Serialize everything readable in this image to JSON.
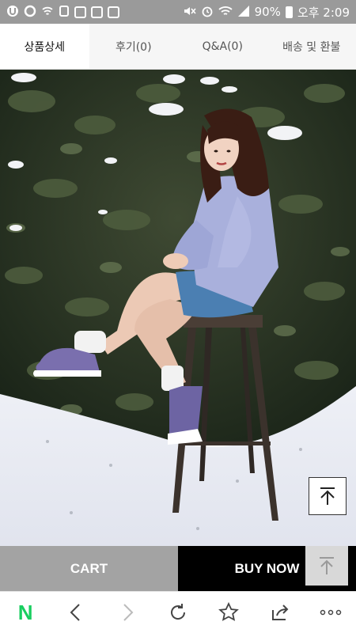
{
  "status_bar": {
    "app_icons": [
      "u-circle-icon",
      "o-circle-icon",
      "wifi-call-icon",
      "tag-icon",
      "app-tile-icon",
      "app-tile-icon",
      "app-tile-icon"
    ],
    "right_icons": [
      "mute-icon",
      "alarm-icon",
      "wifi-icon",
      "signal-icon"
    ],
    "battery": "90%",
    "time": "오후 2:09"
  },
  "tabs": [
    {
      "label": "상품상세",
      "active": true
    },
    {
      "label": "후기(0)",
      "active": false
    },
    {
      "label": "Q&A(0)",
      "active": false
    },
    {
      "label": "배송 및 환불",
      "active": false
    }
  ],
  "hero": {
    "description_icon": "product-photo"
  },
  "actions": {
    "cart_label": "CART",
    "buy_label": "BUY NOW"
  },
  "browser_bar": {
    "logo": "N",
    "buttons": [
      "naver-home",
      "back",
      "forward",
      "reload",
      "bookmark",
      "share",
      "more"
    ]
  },
  "colors": {
    "status_bg": "#9a9a9a",
    "cart_bg": "#a3a3a3",
    "buy_bg": "#000000",
    "naver_green": "#19ce60"
  }
}
